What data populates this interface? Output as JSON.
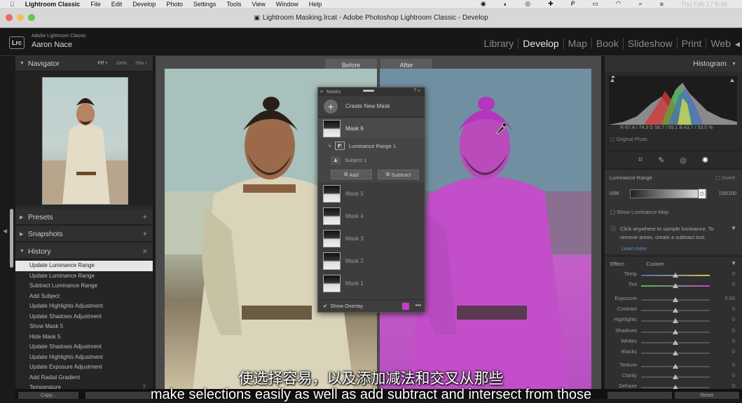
{
  "menubar": {
    "app": "Lightroom Classic",
    "items": [
      "File",
      "Edit",
      "Develop",
      "Photo",
      "Settings",
      "Tools",
      "View",
      "Window",
      "Help"
    ],
    "clock": "Thu Feb 17  6:40"
  },
  "window": {
    "title": "Lightroom Masking.lrcat - Adobe Photoshop Lightroom Classic - Develop"
  },
  "header": {
    "logo": "Lrc",
    "product": "Adobe Lightroom Classic",
    "user": "Aaron Nace",
    "modules": [
      "Library",
      "Develop",
      "Map",
      "Book",
      "Slideshow",
      "Print",
      "Web"
    ],
    "active_module": "Develop"
  },
  "left": {
    "navigator": {
      "title": "Navigator",
      "opts": [
        "FIT ÷",
        "100%",
        "25% ÷"
      ]
    },
    "presets": {
      "title": "Presets"
    },
    "snapshots": {
      "title": "Snapshots"
    },
    "history": {
      "title": "History",
      "items": [
        {
          "label": "Update Luminance Range",
          "selected": true
        },
        {
          "label": "Update Luminance Range"
        },
        {
          "label": "Subtract Luminance Range"
        },
        {
          "label": "Add Subject"
        },
        {
          "label": "Update Highlights Adjustment"
        },
        {
          "label": "Update Shadows Adjustment"
        },
        {
          "label": "Show Mask 5"
        },
        {
          "label": "Hide Mask 5"
        },
        {
          "label": "Update Shadows Adjustment"
        },
        {
          "label": "Update Highlights Adjustment"
        },
        {
          "label": "Update Exposure Adjustment"
        },
        {
          "label": "Add Radial Gradient"
        },
        {
          "label": "Temperature",
          "value": "7"
        }
      ]
    },
    "copy_label": "Copy..."
  },
  "center": {
    "before_label": "Before",
    "after_label": "After"
  },
  "masks": {
    "title": "Masks",
    "create_label": "Create New Mask",
    "active_mask": "Mask 6",
    "component": "Luminance Range 1",
    "subject": "Subject 1",
    "add_label": "Add",
    "subtract_label": "Subtract",
    "other_masks": [
      "Mask 5",
      "Mask 4",
      "Mask 3",
      "Mask 2",
      "Mask 1"
    ],
    "show_overlay": "Show Overlay",
    "overlay_color": "#c83cc8"
  },
  "right": {
    "histogram": {
      "title": "Histogram",
      "readout": "R  67.4 / 74.3  G  58.7 / 65.1  B  43.7 / 53.5  %",
      "original": "Original Photo"
    },
    "luminance": {
      "label": "Luminance Range",
      "invert": "Invert",
      "min": "0/86",
      "max": "100/100",
      "show_map": "Show Luminance Map",
      "tip": "Click anywhere to sample luminance. To remove areas, create a subtract tool.",
      "learn_more": "Learn more"
    },
    "effect": {
      "label": "Effect :",
      "value": "Custom",
      "sliders": [
        {
          "name": "Temp",
          "value": "0",
          "level": 0.5
        },
        {
          "name": "Tint",
          "value": "0",
          "level": 0.5
        },
        {
          "name": "Exposure",
          "value": "0.00",
          "level": 0.5
        },
        {
          "name": "Contrast",
          "value": "0",
          "level": 0.5
        },
        {
          "name": "Highlights",
          "value": "0",
          "level": 0.5
        },
        {
          "name": "Shadows",
          "value": "0",
          "level": 0.5
        },
        {
          "name": "Whites",
          "value": "0",
          "level": 0.5
        },
        {
          "name": "Blacks",
          "value": "0",
          "level": 0.5
        },
        {
          "name": "Texture",
          "value": "0",
          "level": 0.5
        },
        {
          "name": "Clarity",
          "value": "0",
          "level": 0.5
        },
        {
          "name": "Dehaze",
          "value": "0",
          "level": 0.5
        }
      ]
    },
    "reset_label": "Reset"
  },
  "subtitles": {
    "cn": "使选择容易，以及添加减法和交叉从那些",
    "en": "make selections easily as well as add subtract and intersect from those"
  }
}
